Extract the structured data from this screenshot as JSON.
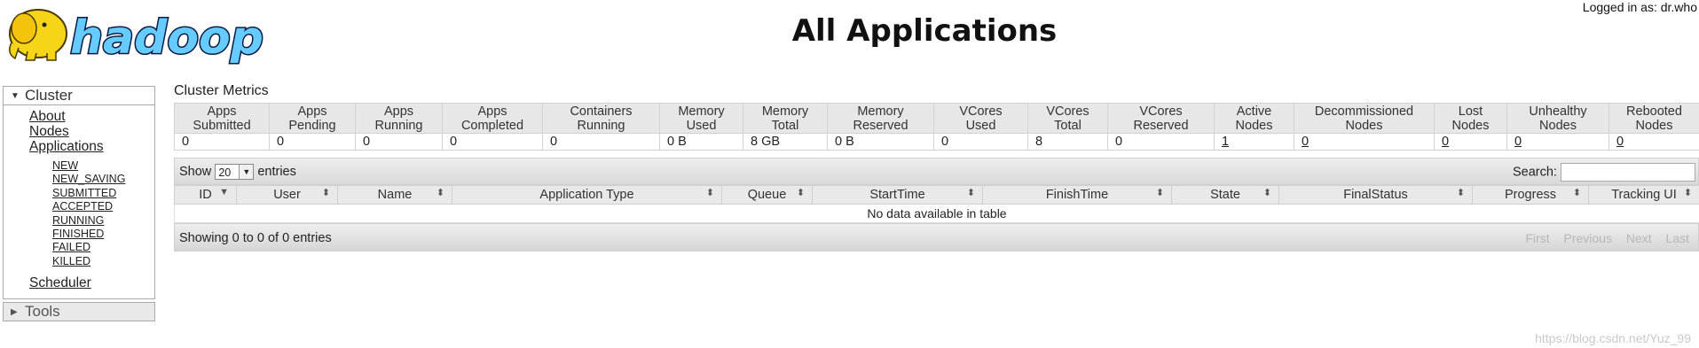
{
  "header": {
    "logo_text": "hadoop",
    "title": "All Applications",
    "logged_in": "Logged in as: dr.who"
  },
  "nav": {
    "cluster_label": "Cluster",
    "links": [
      "About",
      "Nodes",
      "Applications"
    ],
    "app_states": [
      "NEW",
      "NEW_SAVING",
      "SUBMITTED",
      "ACCEPTED",
      "RUNNING",
      "FINISHED",
      "FAILED",
      "KILLED"
    ],
    "scheduler": "Scheduler",
    "tools_label": "Tools"
  },
  "metrics": {
    "title": "Cluster Metrics",
    "headers": [
      [
        "Apps",
        "Submitted"
      ],
      [
        "Apps",
        "Pending"
      ],
      [
        "Apps",
        "Running"
      ],
      [
        "Apps",
        "Completed"
      ],
      [
        "Containers",
        "Running"
      ],
      [
        "Memory",
        "Used"
      ],
      [
        "Memory",
        "Total"
      ],
      [
        "Memory",
        "Reserved"
      ],
      [
        "VCores",
        "Used"
      ],
      [
        "VCores",
        "Total"
      ],
      [
        "VCores",
        "Reserved"
      ],
      [
        "Active",
        "Nodes"
      ],
      [
        "Decommissioned",
        "Nodes"
      ],
      [
        "Lost",
        "Nodes"
      ],
      [
        "Unhealthy",
        "Nodes"
      ],
      [
        "Rebooted",
        "Nodes"
      ]
    ],
    "values": [
      "0",
      "0",
      "0",
      "0",
      "0",
      "0 B",
      "8 GB",
      "0 B",
      "0",
      "8",
      "0",
      "1",
      "0",
      "0",
      "0",
      "0"
    ]
  },
  "table": {
    "show_label": "Show",
    "entries_label": "entries",
    "page_size": "20",
    "search_label": "Search:",
    "columns": [
      "ID",
      "User",
      "Name",
      "Application Type",
      "Queue",
      "StartTime",
      "FinishTime",
      "State",
      "FinalStatus",
      "Progress",
      "Tracking UI"
    ],
    "empty_text": "No data available in table",
    "info_text": "Showing 0 to 0 of 0 entries",
    "pager": [
      "First",
      "Previous",
      "Next",
      "Last"
    ]
  },
  "watermark": "https://blog.csdn.net/Yuz_99"
}
